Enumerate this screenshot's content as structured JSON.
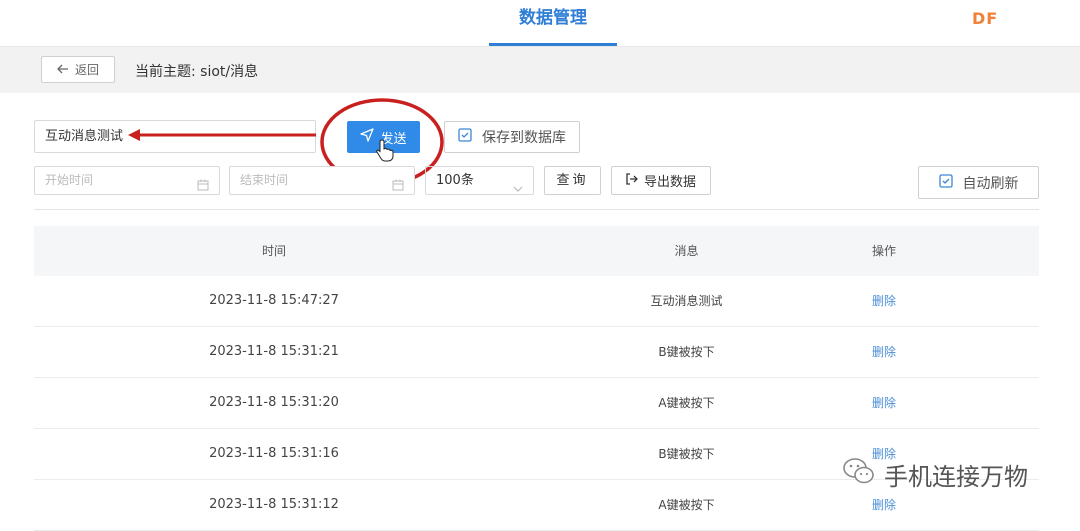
{
  "header": {
    "nav_tab": "数据管理",
    "logo": "DF"
  },
  "subbar": {
    "back_label": "返回",
    "topic_label": "当前主题: siot/消息"
  },
  "compose": {
    "message_value": "互动消息测试",
    "send_label": "发送",
    "save_label": "保存到数据库"
  },
  "filters": {
    "start_placeholder": "开始时间",
    "end_placeholder": "结束时间",
    "limit_value": "100条",
    "query_label": "查询",
    "export_label": "导出数据",
    "auto_refresh_label": "自动刷新"
  },
  "table": {
    "headers": {
      "time": "时间",
      "message": "消息",
      "action": "操作"
    },
    "rows": [
      {
        "time": "2023-11-8 15:47:27",
        "message": "互动消息测试",
        "action": "删除"
      },
      {
        "time": "2023-11-8 15:31:21",
        "message": "B键被按下",
        "action": "删除"
      },
      {
        "time": "2023-11-8 15:31:20",
        "message": "A键被按下",
        "action": "删除"
      },
      {
        "time": "2023-11-8 15:31:16",
        "message": "B键被按下",
        "action": "删除"
      },
      {
        "time": "2023-11-8 15:31:12",
        "message": "A键被按下",
        "action": "删除"
      }
    ]
  },
  "watermark": {
    "text": "手机连接万物"
  },
  "colors": {
    "primary": "#2f8ae8",
    "accent_orange": "#f0803a",
    "annotation_red": "#c8201e",
    "link": "#4a8fd6"
  }
}
